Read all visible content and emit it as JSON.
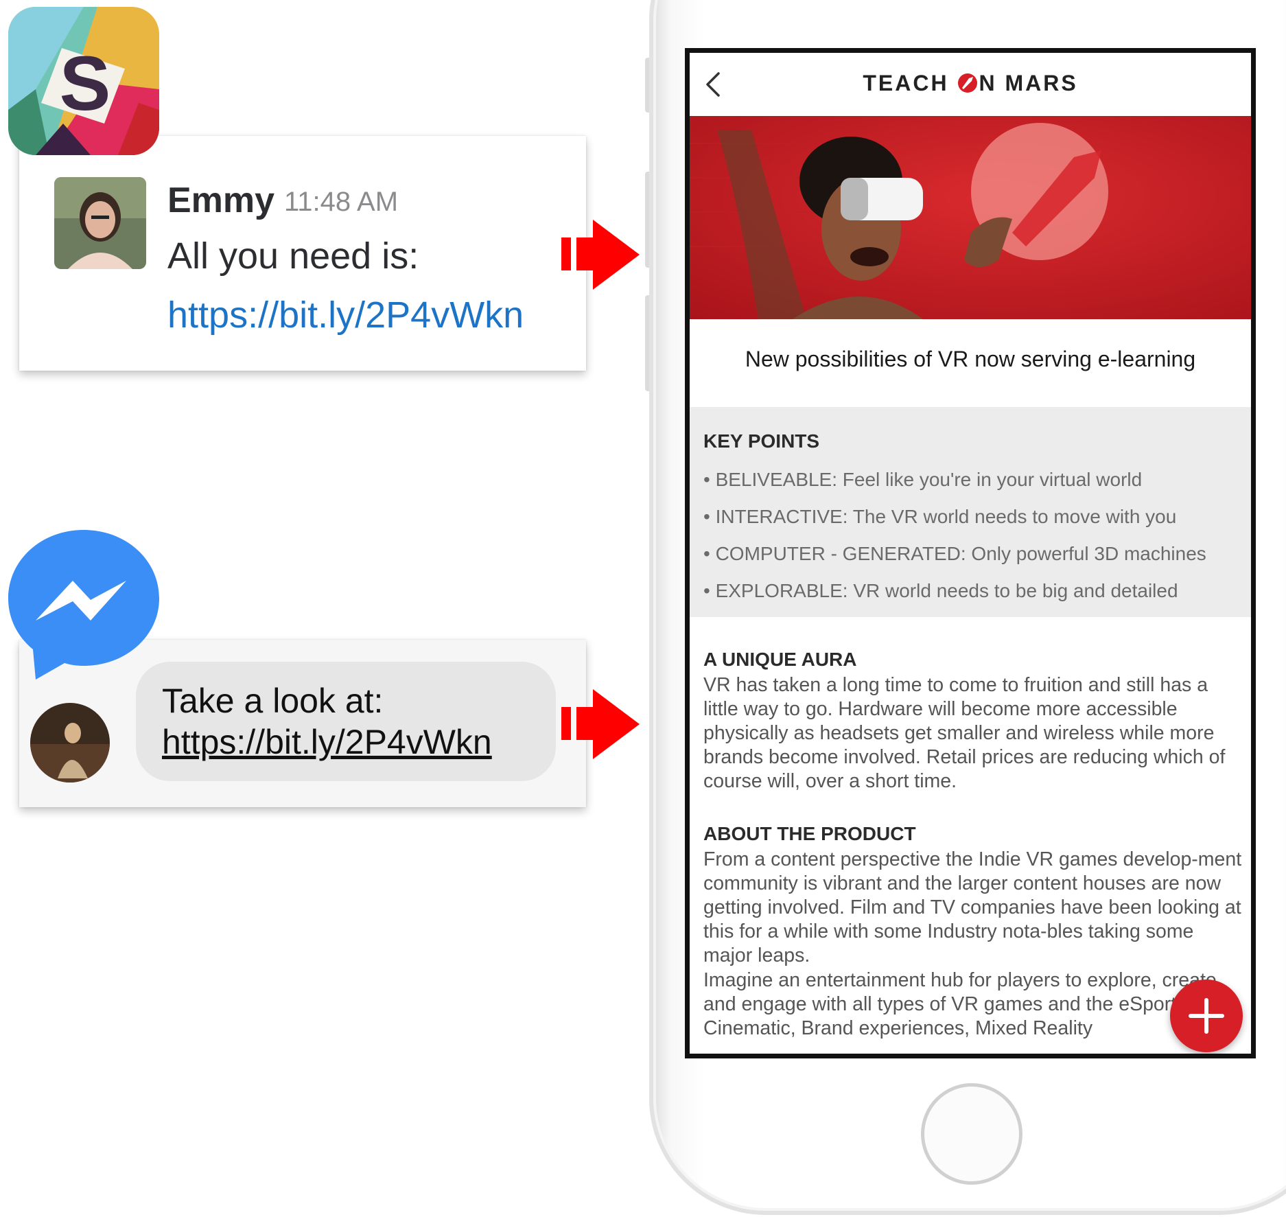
{
  "slack": {
    "logo_letter": "S",
    "sender": "Emmy",
    "time": "11:48 AM",
    "message": "All you need is:",
    "link": "https://bit.ly/2P4vWkn"
  },
  "messenger": {
    "message": "Take a look at:",
    "link": "https://bit.ly/2P4vWkn"
  },
  "app": {
    "brand_before": "TEACH ",
    "brand_after": "N MARS",
    "article_title": "New possibilities of VR now serving e-learning",
    "key_points": {
      "heading": "KEY POINTS",
      "items": [
        "• BELIVEABLE: Feel like you're in your virtual world",
        "• INTERACTIVE: The VR world needs to move with you",
        "• COMPUTER - GENERATED: Only powerful 3D machines",
        "• EXPLORABLE: VR world needs to be big and detailed"
      ]
    },
    "unique_aura": {
      "heading": "A UNIQUE AURA",
      "body": "VR has taken a long time to come to fruition and still has a little way to go. Hardware will become more accessible physically as headsets get smaller and wireless while more brands become involved. Retail prices are reducing which of course will, over a short time."
    },
    "about_product": {
      "heading": "ABOUT THE PRODUCT",
      "body": "From a content perspective the Indie VR games develop-ment community is vibrant and the larger content houses are now getting involved. Film and TV companies have been looking at this for a while with some Industry nota-bles taking some major leaps.",
      "body2": "Imagine an entertainment hub for players to explore, create and engage with all types of VR games and the eSports, Cinematic, Brand experiences, Mixed Reality"
    }
  },
  "colors": {
    "accent_red": "#d61f26",
    "arrow_red": "#ff0000",
    "slack_link": "#1d74c6",
    "messenger_blue": "#3a8ef5"
  },
  "icons": [
    "slack-logo-icon",
    "messenger-logo-icon",
    "arrow-right-icon",
    "back-chevron-icon",
    "rocket-icon",
    "plus-icon"
  ]
}
